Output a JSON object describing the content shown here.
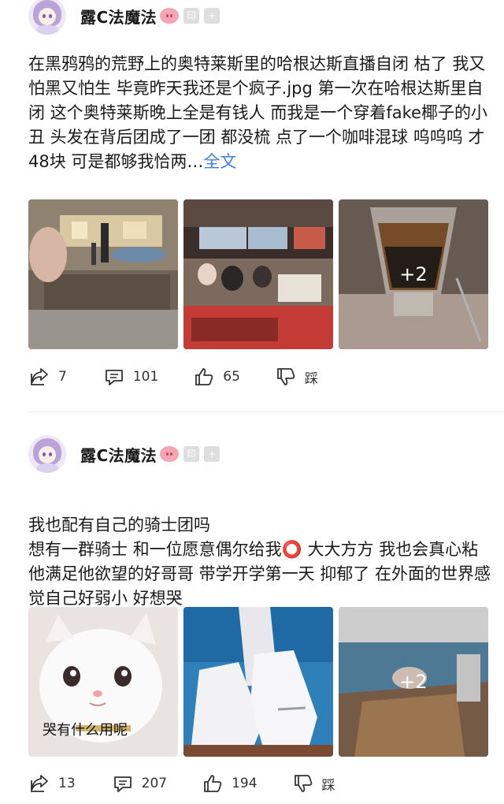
{
  "posts": [
    {
      "username": "露C法魔法",
      "badges": [
        "印",
        "+"
      ],
      "text": "在黑鸦鸦的荒野上的奥特莱斯里的哈根达斯直播自闭 枯了 我又怕黑又怕生 毕竟昨天我还是个疯子.jpg 第一次在哈根达斯里自闭 这个奥特莱斯晚上全是有钱人 而我是一个穿着fake椰子的小丑 头发在背后团成了一团 都没梳 点了一个咖啡混球 呜呜呜 才48块 可是都够我恰两…",
      "more_label": "全文",
      "more_count": "+2",
      "image_caption": "",
      "share_count": "7",
      "comment_count": "101",
      "like_count": "65",
      "dislike_label": "踩"
    },
    {
      "username": "露C法魔法",
      "badges": [
        "印",
        "+"
      ],
      "text": "我也配有自己的骑士团吗\n想有一群骑士 和一位愿意偶尔给我⭕ 大大方方 我也会真心粘他满足他欲望的好哥哥 带学开学第一天 抑郁了 在外面的世界感觉自己好弱小 好想哭",
      "more_label": "",
      "more_count": "+2",
      "image_caption": "哭有什么用呢",
      "share_count": "13",
      "comment_count": "207",
      "like_count": "194",
      "dislike_label": "踩"
    }
  ],
  "colors": {
    "link": "#3d7fe0",
    "text": "#1a1a1a",
    "icon": "#333333"
  },
  "icons": [
    "share-icon",
    "comment-icon",
    "thumbs-up-icon",
    "thumbs-down-icon"
  ]
}
